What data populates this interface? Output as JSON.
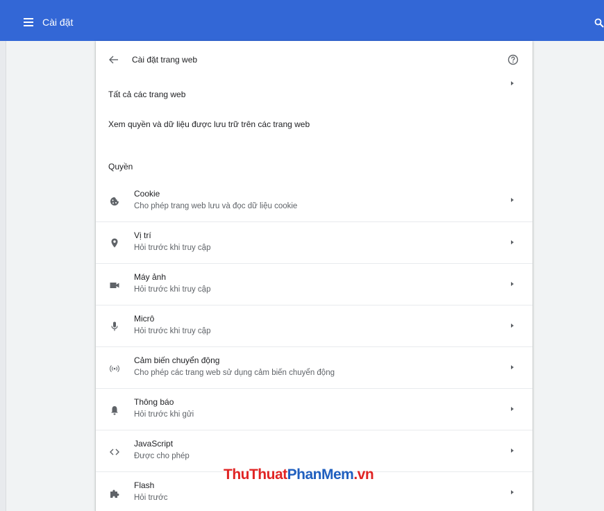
{
  "topbar": {
    "title": "Cài đặt",
    "color": "#3367d6",
    "menu_icon": "hamburger-menu-icon",
    "search_icon": "search-icon"
  },
  "page": {
    "title": "Cài đặt trang web",
    "back_icon": "arrow-back-icon",
    "help_icon": "help-circle-icon"
  },
  "all_sites": {
    "heading": "Tất cả các trang web",
    "link_label": "Xem quyền và dữ liệu được lưu trữ trên các trang web"
  },
  "permissions": {
    "heading": "Quyền",
    "items": [
      {
        "title": "Cookie",
        "subtitle": "Cho phép trang web lưu và đọc dữ liệu cookie",
        "icon": "cookie-icon"
      },
      {
        "title": "Vị trí",
        "subtitle": "Hỏi trước khi truy cập",
        "icon": "location-pin-icon"
      },
      {
        "title": "Máy ảnh",
        "subtitle": "Hỏi trước khi truy cập",
        "icon": "camera-icon"
      },
      {
        "title": "Micrô",
        "subtitle": "Hỏi trước khi truy cập",
        "icon": "microphone-icon"
      },
      {
        "title": "Cảm biến chuyển động",
        "subtitle": "Cho phép các trang web sử dụng cảm biến chuyển động",
        "icon": "motion-sensor-icon"
      },
      {
        "title": "Thông báo",
        "subtitle": "Hỏi trước khi gửi",
        "icon": "bell-icon"
      },
      {
        "title": "JavaScript",
        "subtitle": "Được cho phép",
        "icon": "code-icon"
      },
      {
        "title": "Flash",
        "subtitle": "Hỏi trước",
        "icon": "puzzle-piece-icon"
      }
    ]
  },
  "watermark": {
    "part1": "ThuThuat",
    "part2": "PhanMem",
    "part3": ".vn"
  }
}
